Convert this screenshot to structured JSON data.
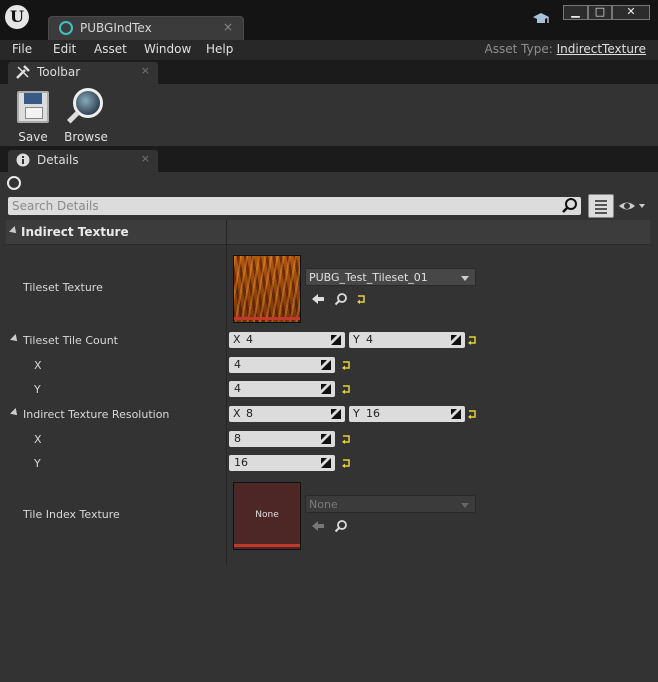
{
  "window": {
    "tab_title": "PUBGIndTex",
    "tab_close": "×",
    "min_label": "▁",
    "max_label": "□",
    "close_label": "✕"
  },
  "menu": {
    "items": [
      "File",
      "Edit",
      "Asset",
      "Window",
      "Help"
    ],
    "asset_type_key": "Asset Type:",
    "asset_type_value": "IndirectTexture"
  },
  "toolbar": {
    "tab_label": "Toolbar",
    "close": "×",
    "save_label": "Save",
    "browse_label": "Browse"
  },
  "details": {
    "tab_label": "Details",
    "close": "×",
    "search_placeholder": "Search Details",
    "section_title": "Indirect Texture",
    "tileset_texture": {
      "label": "Tileset Texture",
      "value": "PUBG_Test_Tileset_01"
    },
    "tileset_tile_count": {
      "label": "Tileset Tile Count",
      "x_axis": "X",
      "y_axis": "Y",
      "x": "4",
      "y": "4",
      "x_label": "X",
      "y_label": "Y"
    },
    "indirect_resolution": {
      "label": "Indirect Texture Resolution",
      "x_axis": "X",
      "y_axis": "Y",
      "x": "8",
      "y": "16",
      "x_label": "X",
      "y_label": "Y"
    },
    "tile_index_texture": {
      "label": "Tile Index Texture",
      "thumb_label": "None",
      "value": "None"
    }
  }
}
